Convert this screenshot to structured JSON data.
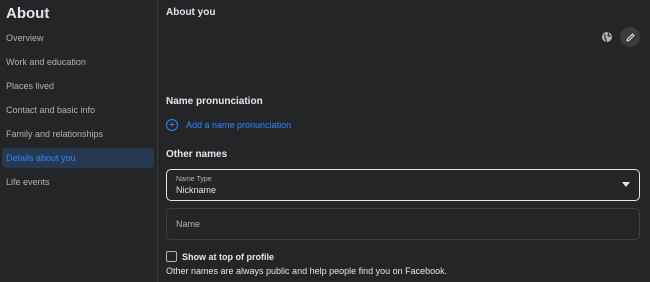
{
  "sidebar": {
    "title": "About",
    "items": [
      {
        "label": "Overview"
      },
      {
        "label": "Work and education"
      },
      {
        "label": "Places lived"
      },
      {
        "label": "Contact and basic info"
      },
      {
        "label": "Family and relationships"
      },
      {
        "label": "Details about you",
        "active": true
      },
      {
        "label": "Life events"
      }
    ]
  },
  "main": {
    "about_you_title": "About you",
    "privacy_icon": "globe-icon",
    "edit_icon": "pencil-icon",
    "name_pronunciation": {
      "title": "Name pronunciation",
      "add_label": "Add a name pronunciation"
    },
    "other_names": {
      "title": "Other names",
      "name_type_label": "Name Type",
      "name_type_value": "Nickname",
      "name_placeholder": "Name",
      "show_at_top_label": "Show at top of profile",
      "show_at_top_checked": false,
      "helper_text": "Other names are always public and help people find you on Facebook."
    }
  },
  "colors": {
    "accent": "#2d88ff",
    "active_bg": "#263951",
    "surface": "#242526",
    "text_primary": "#e4e6eb",
    "text_secondary": "#b0b3b8"
  }
}
